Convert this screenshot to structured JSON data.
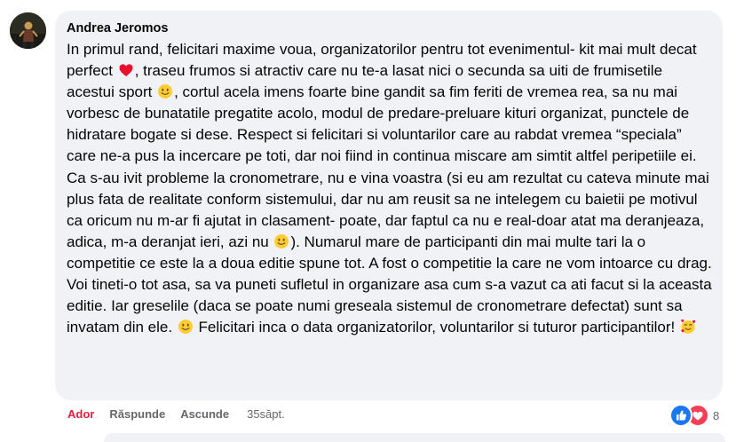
{
  "comment": {
    "author": "Andrea Jeromos",
    "segments": [
      {
        "text": "In primul rand, felicitari maxime voua, organizatorilor pentru tot evenimentul- kit mai mult decat perfect "
      },
      {
        "emoji": "red-heart-icon"
      },
      {
        "text": ", traseu frumos si atractiv care nu te-a lasat nici o secunda sa uiti de frumisetile acestui sport "
      },
      {
        "emoji": "slightly-smiling-face-icon"
      },
      {
        "text": ", cortul acela imens foarte bine gandit sa fim feriti de vremea rea, sa nu mai vorbesc de bunatatile pregatite acolo, modul de predare-preluare kituri organizat, punctele de hidratare bogate si dese. Respect si felicitari si voluntarilor care au rabdat vremea “speciala” care ne-a pus la incercare pe toti, dar noi fiind in continua miscare am simtit altfel peripetiile ei. Ca s-au ivit probleme la cronometrare, nu e vina voastra (si eu am rezultat cu cateva minute mai plus fata de realitate conform sistemului, dar nu am reusit sa ne intelegem cu baietii pe motivul ca oricum nu m-ar fi ajutat in clasament- poate, dar faptul ca nu e real-doar atat ma deranjeaza, adica, m-a deranjat ieri, azi nu "
      },
      {
        "emoji": "slightly-smiling-face-icon"
      },
      {
        "text": "). Numarul mare de participanti din mai multe tari la o competitie ce este la a doua editie spune tot. A fost o competitie la care ne vom intoarce cu drag. Voi tineti-o tot asa, sa va puneti sufletul in organizare asa cum s-a vazut ca ati facut si la aceasta editie. Iar greselile (daca se poate numi greseala sistemul de cronometrare defectat) sunt sa invatam din ele. "
      },
      {
        "emoji": "slightly-smiling-face-icon"
      },
      {
        "text": " Felicitari inca o data organizatorilor, voluntarilor si tuturor participantilor! "
      },
      {
        "emoji": "smiling-face-with-hearts-icon"
      }
    ]
  },
  "actions": {
    "like": "Ador",
    "reply": "Răspunde",
    "hide": "Ascunde",
    "time": "35săpt."
  },
  "reactions": {
    "icons": [
      "like-icon",
      "love-icon"
    ],
    "count": "8"
  },
  "colors": {
    "bubble_bg": "#f0f2f5",
    "text": "#050505",
    "secondary_text": "#65676b",
    "like_active": "#e41e3f",
    "like_icon": "#1877f2",
    "love_icon": "#f33e58"
  }
}
